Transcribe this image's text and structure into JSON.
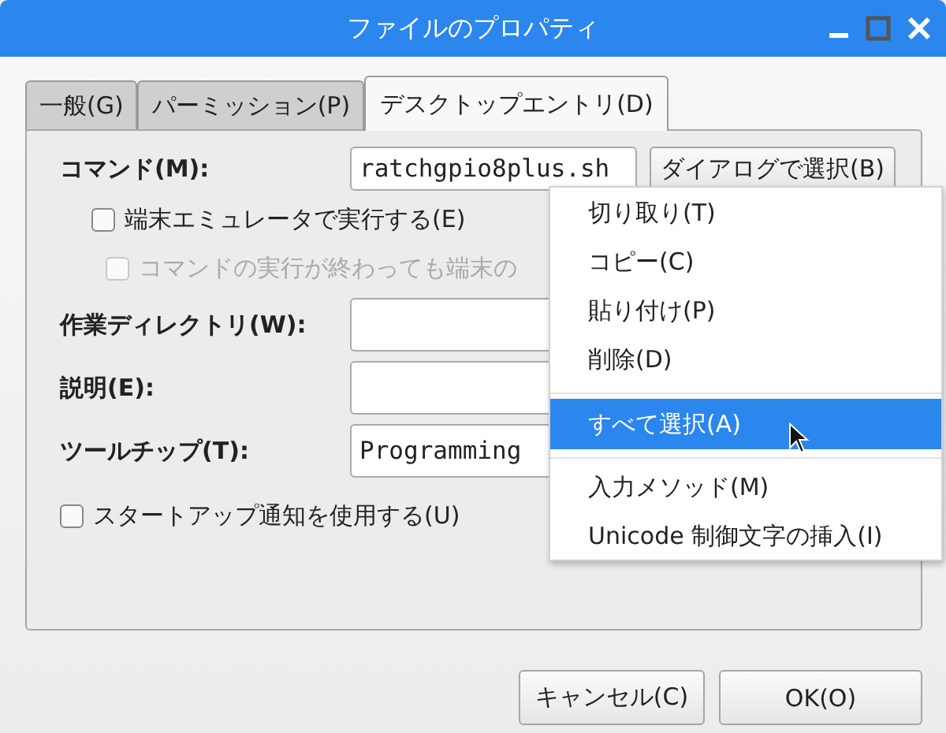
{
  "window": {
    "title": "ファイルのプロパティ"
  },
  "tabs": [
    {
      "label": "一般(G)",
      "selected": false
    },
    {
      "label": "パーミッション(P)",
      "selected": false
    },
    {
      "label": "デスクトップエントリ(D)",
      "selected": true
    }
  ],
  "form": {
    "command": {
      "label": "コマンド(M):",
      "value": "ratchgpio8plus.sh",
      "button": "ダイアログで選択(B)"
    },
    "checks": [
      {
        "label": "端末エミュレータで実行する(E)",
        "checked": false,
        "disabled": false
      },
      {
        "label": "コマンドの実行が終わっても端末の",
        "checked": false,
        "disabled": true
      }
    ],
    "fields": [
      {
        "label": "作業ディレクトリ(W):"
      },
      {
        "label": "説明(E):"
      },
      {
        "label": "ツールチップ(T):",
        "value": "Programming"
      }
    ],
    "startup": {
      "label": "スタートアップ通知を使用する(U)",
      "checked": false
    }
  },
  "context_menu": [
    {
      "kind": "item",
      "label": "切り取り(T)",
      "selected": false
    },
    {
      "kind": "item",
      "label": "コピー(C)",
      "selected": false
    },
    {
      "kind": "item",
      "label": "貼り付け(P)",
      "selected": false
    },
    {
      "kind": "item",
      "label": "削除(D)",
      "selected": false
    },
    {
      "kind": "separator"
    },
    {
      "kind": "item",
      "label": "すべて選択(A)",
      "selected": true
    },
    {
      "kind": "separator"
    },
    {
      "kind": "item",
      "label": "入力メソッド(M)",
      "selected": false
    },
    {
      "kind": "item",
      "label": "Unicode 制御文字の挿入(I)",
      "selected": false
    }
  ],
  "buttons": [
    "キャンセル(C)",
    "OK(O)"
  ]
}
